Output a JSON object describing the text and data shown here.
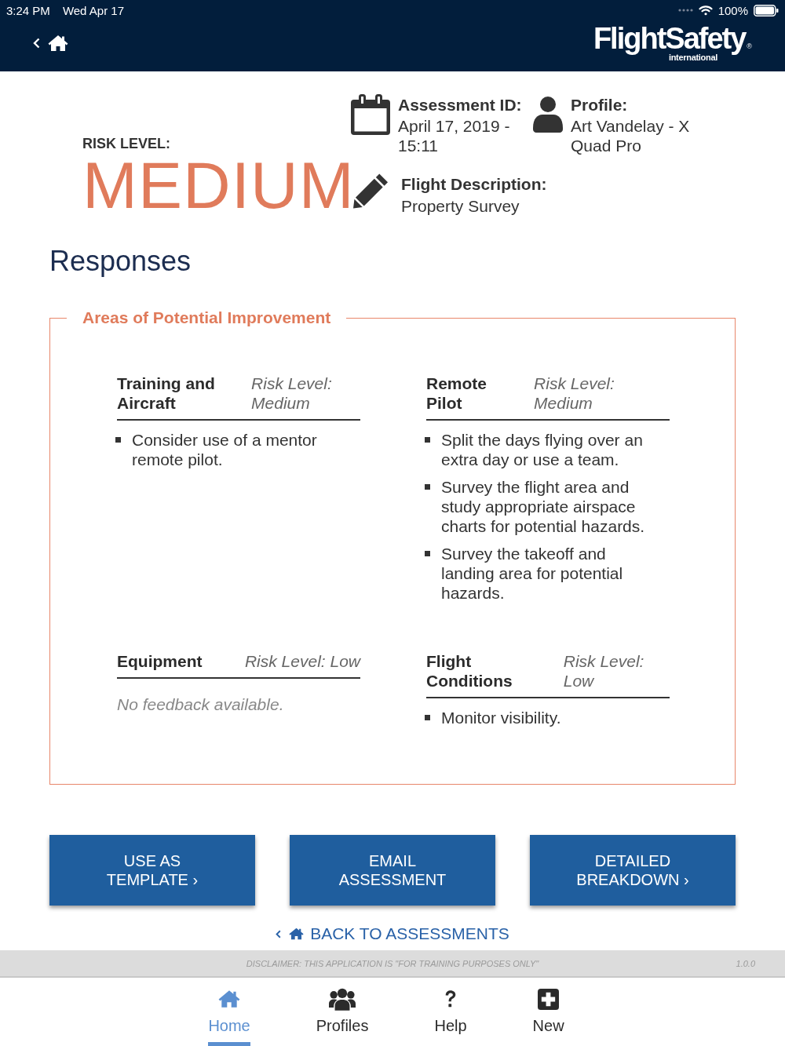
{
  "status_bar": {
    "time": "3:24 PM",
    "date": "Wed Apr 17",
    "battery": "100%"
  },
  "nav_bar": {
    "logo": {
      "name": "FlightSafety",
      "mark": "®",
      "tagline": "international"
    }
  },
  "summary": {
    "risk_label": "RISK LEVEL:",
    "risk_value": "MEDIUM",
    "assessment_id": {
      "label": "Assessment ID:",
      "value": "April 17, 2019 - 15:11"
    },
    "profile": {
      "label": "Profile:",
      "value": "Art Vandelay - X Quad Pro"
    },
    "flight_description": {
      "label": "Flight Description:",
      "value": "Property Survey"
    }
  },
  "responses": {
    "title": "Responses",
    "panel": {
      "title": "Areas of Potential Improvement",
      "categories": [
        {
          "name": "Training and Aircraft",
          "risk": "Risk Level: Medium",
          "feedback": [
            "Consider use of a mentor remote pilot."
          ]
        },
        {
          "name": "Remote Pilot",
          "risk": "Risk Level: Medium",
          "feedback": [
            "Split the days flying over an extra day or use a team.",
            "Survey the flight area and study appropriate airspace charts for potential hazards.",
            "Survey the takeoff and landing area for potential hazards."
          ]
        },
        {
          "name": "Equipment",
          "risk": "Risk Level: Low",
          "empty_message": "No feedback available."
        },
        {
          "name": "Flight Conditions",
          "risk": "Risk Level: Low",
          "feedback": [
            "Monitor visibility."
          ]
        }
      ]
    }
  },
  "buttons": [
    {
      "label": "USE AS TEMPLATE ›"
    },
    {
      "label": "EMAIL ASSESSMENT"
    },
    {
      "label": "DETAILED BREAKDOWN ›"
    }
  ],
  "back_link": {
    "label": "BACK TO ASSESSMENTS"
  },
  "disclaimer": {
    "text": "DISCLAIMER: THIS APPLICATION IS \"FOR TRAINING PURPOSES ONLY\"",
    "version": "1.0.0"
  },
  "tab_bar": [
    {
      "label": "Home",
      "selected": true
    },
    {
      "label": "Profiles",
      "selected": false
    },
    {
      "label": "Help",
      "selected": false
    },
    {
      "label": "New",
      "selected": false
    }
  ]
}
